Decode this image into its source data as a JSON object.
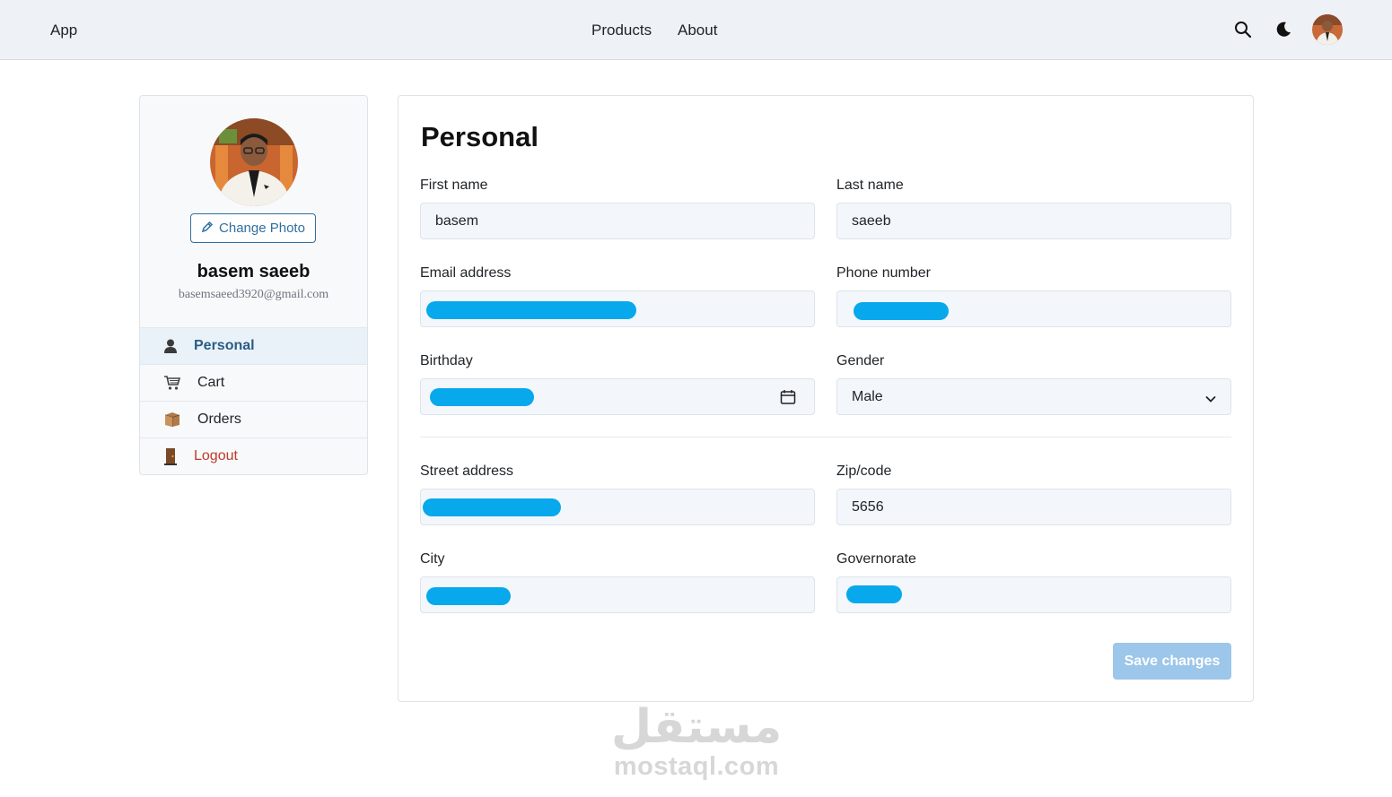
{
  "navbar": {
    "brand": "App",
    "links": [
      "Products",
      "About"
    ],
    "icons": [
      "search-icon",
      "moon-icon"
    ]
  },
  "sidebar": {
    "change_photo_label": "Change Photo",
    "name": "basem saeeb",
    "email": "basemsaeed3920@gmail.com",
    "menu": [
      {
        "label": "Personal",
        "icon": "person-icon",
        "active": true
      },
      {
        "label": "Cart",
        "icon": "cart-icon"
      },
      {
        "label": "Orders",
        "icon": "box-icon"
      },
      {
        "label": "Logout",
        "icon": "door-icon"
      }
    ]
  },
  "form": {
    "title": "Personal",
    "first_name": {
      "label": "First name",
      "value": "basem"
    },
    "last_name": {
      "label": "Last name",
      "value": "saeeb"
    },
    "email": {
      "label": "Email address",
      "value": ""
    },
    "phone": {
      "label": "Phone number",
      "value": ""
    },
    "birthday": {
      "label": "Birthday",
      "value": ""
    },
    "gender": {
      "label": "Gender",
      "value": "Male"
    },
    "street": {
      "label": "Street address",
      "value": ""
    },
    "zip": {
      "label": "Zip/code",
      "value": "5656"
    },
    "city": {
      "label": "City",
      "value": ""
    },
    "governorate": {
      "label": "Governorate",
      "value": ""
    },
    "save_label": "Save changes"
  },
  "watermark": {
    "arabic": "مستقل",
    "latin": "mostaql.com"
  },
  "colors": {
    "navbar_bg": "#eef1f6",
    "accent": "#2f6f9f",
    "logout": "#c0392b",
    "save_button": "#9cc6ea",
    "redaction": "#08a8ec"
  }
}
